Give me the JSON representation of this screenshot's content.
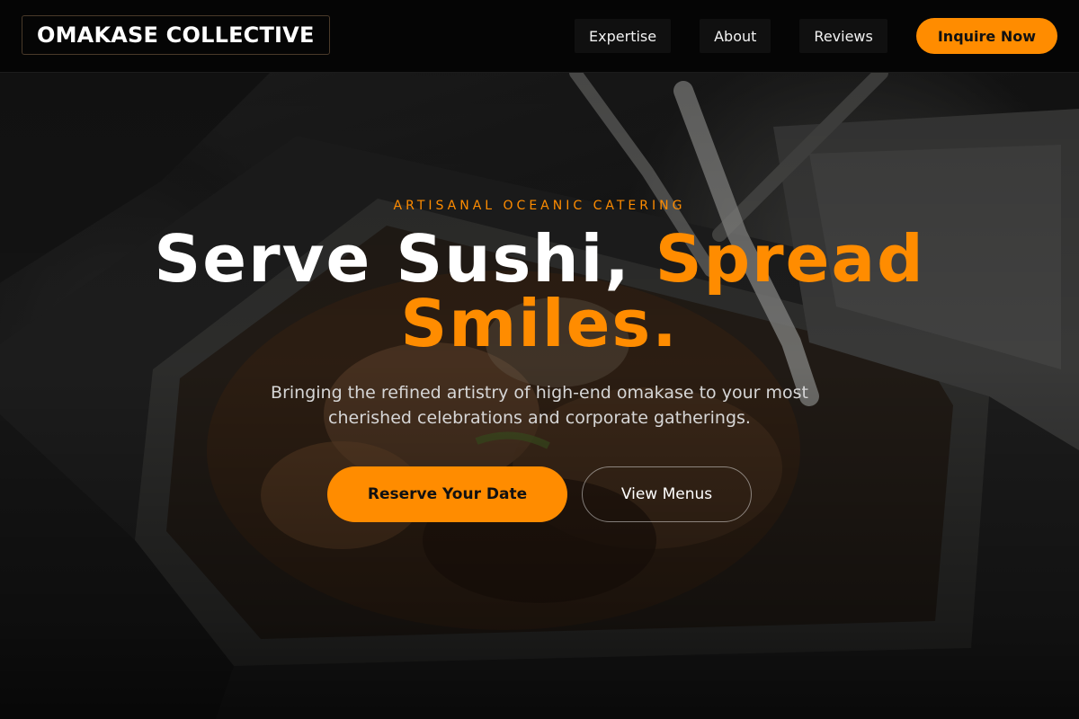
{
  "brand": {
    "name": "OMAKASE COLLECTIVE"
  },
  "nav": {
    "links": [
      {
        "label": "Expertise"
      },
      {
        "label": "About"
      },
      {
        "label": "Reviews"
      }
    ],
    "cta_label": "Inquire Now"
  },
  "hero": {
    "eyebrow": "ARTISANAL OCEANIC CATERING",
    "headline_part1": "Serve Sushi, ",
    "headline_accent": "Spread Smiles.",
    "subtext": "Bringing the refined artistry of high-end omakase to your most cherished celebrations and corporate gatherings.",
    "primary_button": "Reserve Your Date",
    "secondary_button": "View Menus"
  },
  "colors": {
    "accent": "#ff8c00",
    "nav_background": "#050505",
    "text_primary": "#ffffff"
  }
}
